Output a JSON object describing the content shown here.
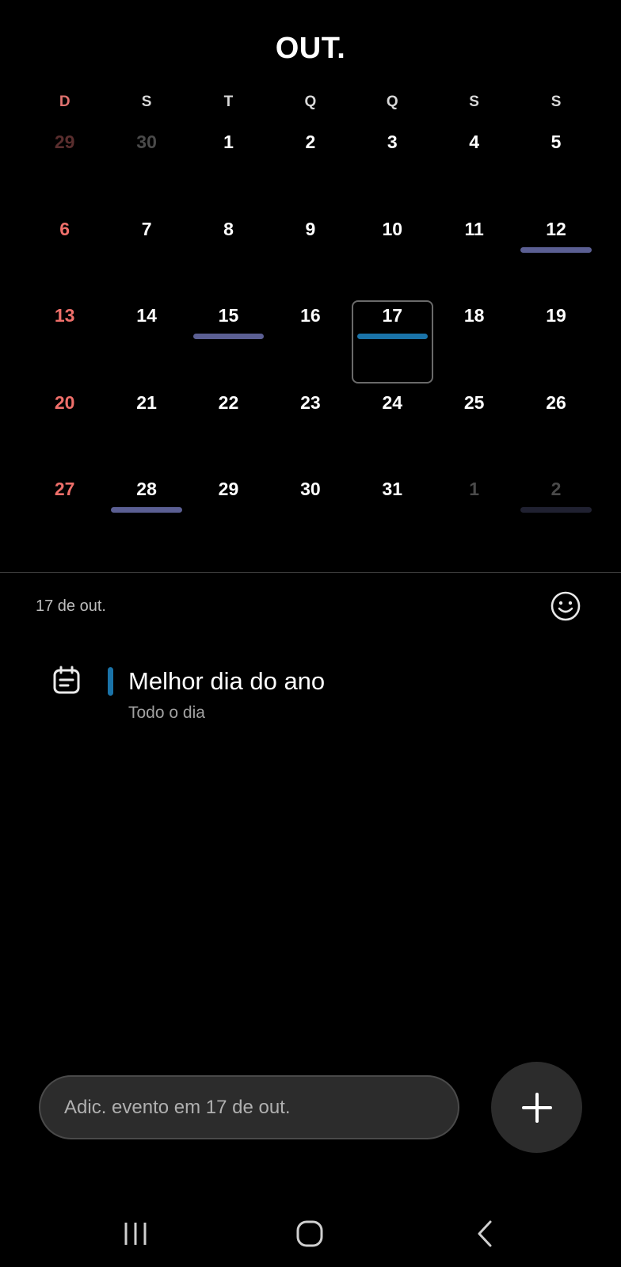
{
  "header": {
    "month": "OUT."
  },
  "weekdays": [
    "D",
    "S",
    "T",
    "Q",
    "Q",
    "S",
    "S"
  ],
  "weeks": [
    [
      {
        "label": "29",
        "muted": true,
        "sun": true
      },
      {
        "label": "30",
        "muted": true
      },
      {
        "label": "1"
      },
      {
        "label": "2"
      },
      {
        "label": "3"
      },
      {
        "label": "4"
      },
      {
        "label": "5"
      }
    ],
    [
      {
        "label": "6",
        "sun": true
      },
      {
        "label": "7"
      },
      {
        "label": "8"
      },
      {
        "label": "9"
      },
      {
        "label": "10"
      },
      {
        "label": "11"
      },
      {
        "label": "12",
        "event_bar": "purple"
      }
    ],
    [
      {
        "label": "13",
        "sun": true
      },
      {
        "label": "14"
      },
      {
        "label": "15",
        "event_bar": "purple"
      },
      {
        "label": "16"
      },
      {
        "label": "17",
        "selected": true,
        "event_bar": "blue"
      },
      {
        "label": "18"
      },
      {
        "label": "19"
      }
    ],
    [
      {
        "label": "20",
        "sun": true
      },
      {
        "label": "21"
      },
      {
        "label": "22"
      },
      {
        "label": "23"
      },
      {
        "label": "24"
      },
      {
        "label": "25"
      },
      {
        "label": "26"
      }
    ],
    [
      {
        "label": "27",
        "sun": true
      },
      {
        "label": "28",
        "event_bar": "purple"
      },
      {
        "label": "29"
      },
      {
        "label": "30"
      },
      {
        "label": "31"
      },
      {
        "label": "1",
        "muted": true
      },
      {
        "label": "2",
        "muted": true,
        "event_bar": "dim"
      }
    ]
  ],
  "selected_day": {
    "label": "17 de out."
  },
  "events": [
    {
      "title": "Melhor dia do ano",
      "subtitle": "Todo o dia",
      "icon": "calendar-note-icon"
    }
  ],
  "quick_add": {
    "placeholder": "Adic. evento em 17 de out."
  },
  "colors": {
    "sunday": "#ef6f6a",
    "event_purple": "#5b5f93",
    "event_blue": "#1a73a8",
    "background": "#000000"
  },
  "icons": {
    "smiley": "smiley-icon",
    "fab": "plus-icon",
    "nav": [
      "recent-apps-icon",
      "home-icon",
      "back-icon"
    ]
  }
}
